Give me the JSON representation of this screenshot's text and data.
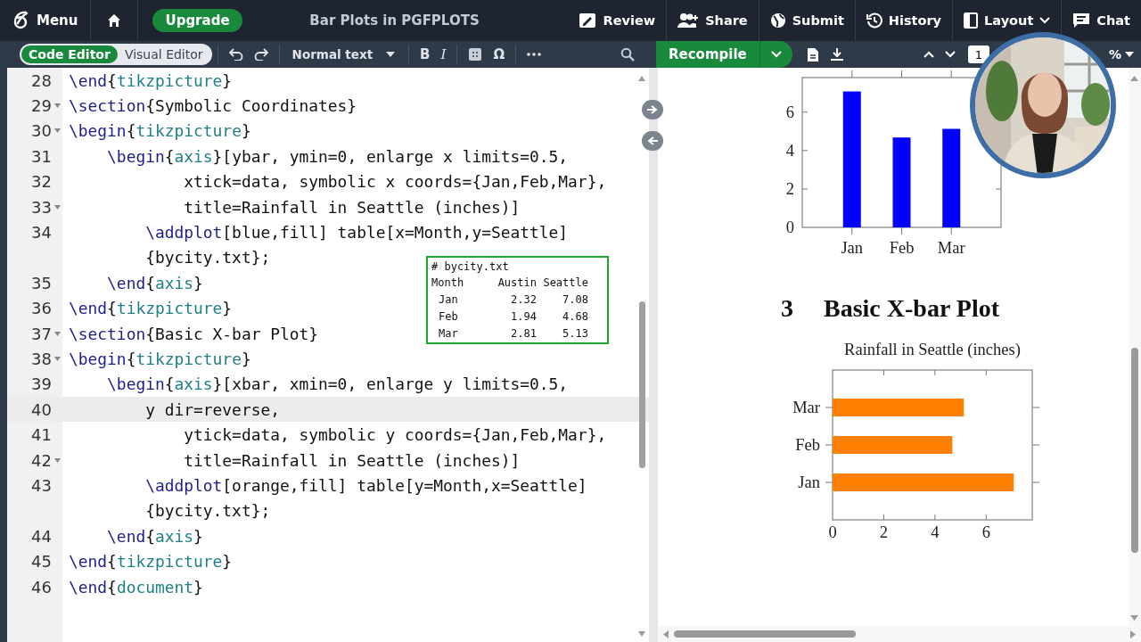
{
  "menu_bar": {
    "menu": "Menu",
    "upgrade": "Upgrade",
    "title": "Bar Plots in PGFPLOTS",
    "actions": [
      {
        "kind": "review",
        "label": "Review"
      },
      {
        "kind": "share",
        "label": "Share"
      },
      {
        "kind": "submit",
        "label": "Submit"
      },
      {
        "kind": "history",
        "label": "History"
      },
      {
        "kind": "layout",
        "label": "Layout"
      },
      {
        "kind": "chat",
        "label": "Chat"
      }
    ]
  },
  "editor_toolbar": {
    "modes": [
      {
        "label": "Code Editor",
        "selected": true
      },
      {
        "label": "Visual Editor",
        "selected": false
      }
    ],
    "text_style": "Normal text",
    "tools": [
      {
        "kind": "bold",
        "label": "B"
      },
      {
        "kind": "italic",
        "label": "I"
      },
      {
        "kind": "table"
      },
      {
        "kind": "symbol",
        "label": "Ω"
      },
      {
        "kind": "more"
      }
    ]
  },
  "preview_toolbar": {
    "recompile": "Recompile",
    "page": "1",
    "zoom": "%"
  },
  "editor": {
    "lines": [
      {
        "number": "28",
        "fold": false,
        "active": false,
        "tokens": [
          {
            "kind": "command",
            "text": "\\end"
          },
          {
            "kind": "plain",
            "text": "{"
          },
          {
            "kind": "env",
            "text": "tikzpicture"
          },
          {
            "kind": "plain",
            "text": "}"
          }
        ]
      },
      {
        "number": "29",
        "fold": true,
        "active": false,
        "tokens": [
          {
            "kind": "command",
            "text": "\\section"
          },
          {
            "kind": "plain",
            "text": "{Symbolic Coordinates}"
          }
        ]
      },
      {
        "number": "30",
        "fold": true,
        "active": false,
        "tokens": [
          {
            "kind": "command",
            "text": "\\begin"
          },
          {
            "kind": "plain",
            "text": "{"
          },
          {
            "kind": "env",
            "text": "tikzpicture"
          },
          {
            "kind": "plain",
            "text": "}"
          }
        ]
      },
      {
        "number": "31",
        "fold": false,
        "active": false,
        "tokens": [
          {
            "kind": "command",
            "text": "    \\begin"
          },
          {
            "kind": "plain",
            "text": "{"
          },
          {
            "kind": "env",
            "text": "axis"
          },
          {
            "kind": "plain",
            "text": "}[ybar, ymin=0, enlarge x limits=0.5,"
          }
        ]
      },
      {
        "number": "32",
        "fold": false,
        "active": false,
        "tokens": [
          {
            "kind": "plain",
            "text": "            xtick=data, symbolic x coords={Jan,Feb,Mar},"
          }
        ]
      },
      {
        "number": "33",
        "fold": true,
        "active": false,
        "tokens": [
          {
            "kind": "plain",
            "text": "            title=Rainfall in Seattle (inches)]"
          }
        ]
      },
      {
        "number": "34",
        "fold": false,
        "active": false,
        "tokens": [
          {
            "kind": "command",
            "text": "        \\addplot"
          },
          {
            "kind": "plain",
            "text": "[blue,fill] table[x=Month,y=Seattle]"
          }
        ]
      },
      {
        "fold": false,
        "active": false,
        "tokens": [
          {
            "kind": "plain",
            "text": "        {bycity.txt};"
          }
        ]
      },
      {
        "number": "35",
        "fold": false,
        "active": false,
        "tokens": [
          {
            "kind": "command",
            "text": "    \\end"
          },
          {
            "kind": "plain",
            "text": "{"
          },
          {
            "kind": "env",
            "text": "axis"
          },
          {
            "kind": "plain",
            "text": "}"
          }
        ]
      },
      {
        "number": "36",
        "fold": false,
        "active": false,
        "tokens": [
          {
            "kind": "command",
            "text": "\\end"
          },
          {
            "kind": "plain",
            "text": "{"
          },
          {
            "kind": "env",
            "text": "tikzpicture"
          },
          {
            "kind": "plain",
            "text": "}"
          }
        ]
      },
      {
        "number": "37",
        "fold": true,
        "active": false,
        "tokens": [
          {
            "kind": "command",
            "text": "\\section"
          },
          {
            "kind": "plain",
            "text": "{Basic X-bar Plot}"
          }
        ]
      },
      {
        "number": "38",
        "fold": true,
        "active": false,
        "tokens": [
          {
            "kind": "command",
            "text": "\\begin"
          },
          {
            "kind": "plain",
            "text": "{"
          },
          {
            "kind": "env",
            "text": "tikzpicture"
          },
          {
            "kind": "plain",
            "text": "}"
          }
        ]
      },
      {
        "number": "39",
        "fold": false,
        "active": false,
        "tokens": [
          {
            "kind": "command",
            "text": "    \\begin"
          },
          {
            "kind": "plain",
            "text": "{"
          },
          {
            "kind": "env",
            "text": "axis"
          },
          {
            "kind": "plain",
            "text": "}[xbar, xmin=0, enlarge y limits=0.5,"
          }
        ]
      },
      {
        "number": "40",
        "fold": false,
        "active": true,
        "tokens": [
          {
            "kind": "plain",
            "text": "        y dir=reverse,"
          }
        ]
      },
      {
        "number": "41",
        "fold": false,
        "active": false,
        "tokens": [
          {
            "kind": "plain",
            "text": "            ytick=data, symbolic y coords={Jan,Feb,Mar},"
          }
        ]
      },
      {
        "number": "42",
        "fold": true,
        "active": false,
        "tokens": [
          {
            "kind": "plain",
            "text": "            title=Rainfall in Seattle (inches)]"
          }
        ]
      },
      {
        "number": "43",
        "fold": false,
        "active": false,
        "tokens": [
          {
            "kind": "command",
            "text": "        \\addplot"
          },
          {
            "kind": "plain",
            "text": "[orange,fill] table[y=Month,x=Seattle]"
          }
        ]
      },
      {
        "fold": false,
        "active": false,
        "tokens": [
          {
            "kind": "plain",
            "text": "        {bycity.txt};"
          }
        ]
      },
      {
        "number": "44",
        "fold": false,
        "active": false,
        "tokens": [
          {
            "kind": "command",
            "text": "    \\end"
          },
          {
            "kind": "plain",
            "text": "{"
          },
          {
            "kind": "env",
            "text": "axis"
          },
          {
            "kind": "plain",
            "text": "}"
          }
        ]
      },
      {
        "number": "45",
        "fold": false,
        "active": false,
        "tokens": [
          {
            "kind": "command",
            "text": "\\end"
          },
          {
            "kind": "plain",
            "text": "{"
          },
          {
            "kind": "env",
            "text": "tikzpicture"
          },
          {
            "kind": "plain",
            "text": "}"
          }
        ]
      },
      {
        "number": "46",
        "fold": false,
        "active": false,
        "tokens": [
          {
            "kind": "command",
            "text": "\\end"
          },
          {
            "kind": "plain",
            "text": "{"
          },
          {
            "kind": "env",
            "text": "document"
          },
          {
            "kind": "plain",
            "text": "}"
          }
        ]
      }
    ]
  },
  "data_note": {
    "title": "# bycity.txt",
    "columns": [
      "Month",
      "Austin",
      "Seattle"
    ],
    "rows": [
      [
        "Jan",
        "2.32",
        "7.08"
      ],
      [
        "Feb",
        "1.94",
        "4.68"
      ],
      [
        "Mar",
        "2.81",
        "5.13"
      ]
    ]
  },
  "preview": {
    "charts_before": [
      {
        "chart_data": {
          "type": "bar",
          "orientation": "vertical",
          "categories": [
            "Jan",
            "Feb",
            "Mar"
          ],
          "series": [
            {
              "color": "#0000ff",
              "values": [
                7.08,
                4.68,
                5.13
              ]
            }
          ],
          "ylim": [
            0,
            7.8
          ],
          "yticks": [
            0,
            2,
            4,
            6
          ]
        }
      }
    ],
    "section": {
      "number": "3",
      "title": "Basic X-bar Plot"
    },
    "charts_after": [
      {
        "chart_data": {
          "type": "bar",
          "orientation": "horizontal",
          "title": "Rainfall in Seattle (inches)",
          "categories": [
            "Mar",
            "Feb",
            "Jan"
          ],
          "series": [
            {
              "color": "#ff8000",
              "values": [
                5.13,
                4.68,
                7.08
              ]
            }
          ],
          "xlim": [
            0,
            7.8
          ],
          "xticks": [
            0,
            2,
            4,
            6
          ]
        }
      }
    ]
  }
}
